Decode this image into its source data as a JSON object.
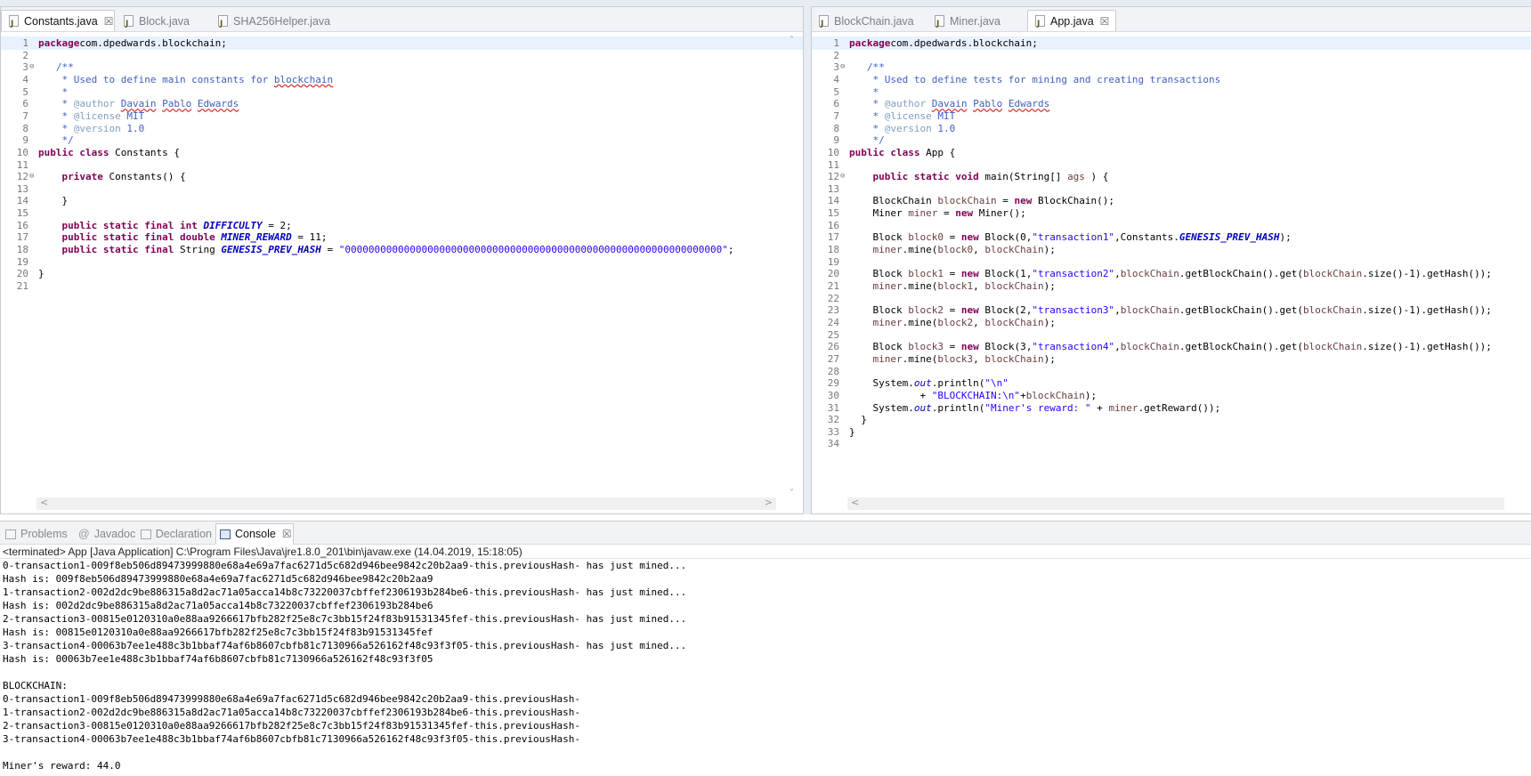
{
  "left_editor": {
    "tabs": [
      {
        "label": "Constants.java",
        "active": true,
        "close": "☒"
      },
      {
        "label": "Block.java",
        "active": false
      },
      {
        "label": "SHA256Helper.java",
        "active": false
      }
    ],
    "lines": [
      [
        [
          "kw",
          "package"
        ],
        [
          "",
          "com.dpedwards.blockchain;"
        ]
      ],
      [],
      [
        [
          "cm",
          "   /**"
        ]
      ],
      [
        [
          "cm",
          "    * Used to define main constants for "
        ],
        [
          "cm ul",
          "blockchain"
        ]
      ],
      [
        [
          "cm",
          "    *"
        ]
      ],
      [
        [
          "cm",
          "    * "
        ],
        [
          "tag",
          "@author"
        ],
        [
          "cm",
          " "
        ],
        [
          "cm ul",
          "Davain"
        ],
        [
          "cm",
          " "
        ],
        [
          "cm ul",
          "Pablo"
        ],
        [
          "cm",
          " "
        ],
        [
          "cm ul",
          "Edwards"
        ]
      ],
      [
        [
          "cm",
          "    * "
        ],
        [
          "tag",
          "@license"
        ],
        [
          "cm",
          " MIT"
        ]
      ],
      [
        [
          "cm",
          "    * "
        ],
        [
          "tag",
          "@version"
        ],
        [
          "cm",
          " 1.0"
        ]
      ],
      [
        [
          "cm",
          "    */"
        ]
      ],
      [
        [
          "kw",
          "public"
        ],
        [
          "",
          " "
        ],
        [
          "kw",
          "class"
        ],
        [
          "",
          " Constants {"
        ]
      ],
      [],
      [
        [
          "",
          "    "
        ],
        [
          "kw",
          "private"
        ],
        [
          "",
          " Constants() {"
        ]
      ],
      [],
      [
        [
          "",
          "    }"
        ]
      ],
      [],
      [
        [
          "",
          "    "
        ],
        [
          "kw",
          "public static final int"
        ],
        [
          "",
          " "
        ],
        [
          "cst",
          "DIFFICULTY"
        ],
        [
          "",
          " = 2;"
        ]
      ],
      [
        [
          "",
          "    "
        ],
        [
          "kw",
          "public static final double"
        ],
        [
          "",
          " "
        ],
        [
          "cst",
          "MINER_REWARD"
        ],
        [
          "",
          " = 11;"
        ]
      ],
      [
        [
          "",
          "    "
        ],
        [
          "kw",
          "public static final"
        ],
        [
          "",
          " String "
        ],
        [
          "cst",
          "GENESIS_PREV_HASH"
        ],
        [
          "",
          " = "
        ],
        [
          "str",
          "\"0000000000000000000000000000000000000000000000000000000000000000\""
        ],
        [
          "",
          ";"
        ]
      ],
      [],
      [
        [
          "",
          "}"
        ]
      ],
      []
    ],
    "fold_lines": [
      3,
      12
    ]
  },
  "right_editor": {
    "tabs": [
      {
        "label": "BlockChain.java",
        "active": false
      },
      {
        "label": "Miner.java",
        "active": false
      },
      {
        "label": "App.java",
        "active": true,
        "close": "☒"
      }
    ],
    "lines": [
      [
        [
          "kw",
          "package"
        ],
        [
          "",
          "com.dpedwards.blockchain;"
        ]
      ],
      [],
      [
        [
          "cm",
          "   /**"
        ]
      ],
      [
        [
          "cm",
          "    * Used to define tests for mining and creating transactions"
        ]
      ],
      [
        [
          "cm",
          "    *"
        ]
      ],
      [
        [
          "cm",
          "    * "
        ],
        [
          "tag",
          "@author"
        ],
        [
          "cm",
          " "
        ],
        [
          "cm ul",
          "Davain"
        ],
        [
          "cm",
          " "
        ],
        [
          "cm ul",
          "Pablo"
        ],
        [
          "cm",
          " "
        ],
        [
          "cm ul",
          "Edwards"
        ]
      ],
      [
        [
          "cm",
          "    * "
        ],
        [
          "tag",
          "@license"
        ],
        [
          "cm",
          " MIT"
        ]
      ],
      [
        [
          "cm",
          "    * "
        ],
        [
          "tag",
          "@version"
        ],
        [
          "cm",
          " 1.0"
        ]
      ],
      [
        [
          "cm",
          "    */"
        ]
      ],
      [
        [
          "kw",
          "public"
        ],
        [
          "",
          " "
        ],
        [
          "kw",
          "class"
        ],
        [
          "",
          " App {"
        ]
      ],
      [],
      [
        [
          "",
          "    "
        ],
        [
          "kw",
          "public static void"
        ],
        [
          "",
          " main(String[] "
        ],
        [
          "var",
          "ags"
        ],
        [
          "",
          " ) {"
        ]
      ],
      [],
      [
        [
          "",
          "    BlockChain "
        ],
        [
          "var",
          "blockChain"
        ],
        [
          "",
          " = "
        ],
        [
          "kw",
          "new"
        ],
        [
          "",
          " BlockChain();"
        ]
      ],
      [
        [
          "",
          "    Miner "
        ],
        [
          "var",
          "miner"
        ],
        [
          "",
          " = "
        ],
        [
          "kw",
          "new"
        ],
        [
          "",
          " Miner();"
        ]
      ],
      [],
      [
        [
          "",
          "    Block "
        ],
        [
          "var",
          "block0"
        ],
        [
          "",
          " = "
        ],
        [
          "kw",
          "new"
        ],
        [
          "",
          " Block(0,"
        ],
        [
          "str",
          "\"transaction1\""
        ],
        [
          "",
          ",Constants."
        ],
        [
          "cst",
          "GENESIS_PREV_HASH"
        ],
        [
          "",
          ");"
        ]
      ],
      [
        [
          "",
          "    "
        ],
        [
          "var",
          "miner"
        ],
        [
          "",
          ".mine("
        ],
        [
          "var",
          "block0"
        ],
        [
          "",
          ", "
        ],
        [
          "var",
          "blockChain"
        ],
        [
          "",
          ");"
        ]
      ],
      [],
      [
        [
          "",
          "    Block "
        ],
        [
          "var",
          "block1"
        ],
        [
          "",
          " = "
        ],
        [
          "kw",
          "new"
        ],
        [
          "",
          " Block(1,"
        ],
        [
          "str",
          "\"transaction2\""
        ],
        [
          "",
          ","
        ],
        [
          "var",
          "blockChain"
        ],
        [
          "",
          ".getBlockChain().get("
        ],
        [
          "var",
          "blockChain"
        ],
        [
          "",
          ".size()-1).getHash());"
        ]
      ],
      [
        [
          "",
          "    "
        ],
        [
          "var",
          "miner"
        ],
        [
          "",
          ".mine("
        ],
        [
          "var",
          "block1"
        ],
        [
          "",
          ", "
        ],
        [
          "var",
          "blockChain"
        ],
        [
          "",
          ");"
        ]
      ],
      [],
      [
        [
          "",
          "    Block "
        ],
        [
          "var",
          "block2"
        ],
        [
          "",
          " = "
        ],
        [
          "kw",
          "new"
        ],
        [
          "",
          " Block(2,"
        ],
        [
          "str",
          "\"transaction3\""
        ],
        [
          "",
          ","
        ],
        [
          "var",
          "blockChain"
        ],
        [
          "",
          ".getBlockChain().get("
        ],
        [
          "var",
          "blockChain"
        ],
        [
          "",
          ".size()-1).getHash());"
        ]
      ],
      [
        [
          "",
          "    "
        ],
        [
          "var",
          "miner"
        ],
        [
          "",
          ".mine("
        ],
        [
          "var",
          "block2"
        ],
        [
          "",
          ", "
        ],
        [
          "var",
          "blockChain"
        ],
        [
          "",
          ");"
        ]
      ],
      [],
      [
        [
          "",
          "    Block "
        ],
        [
          "var",
          "block3"
        ],
        [
          "",
          " = "
        ],
        [
          "kw",
          "new"
        ],
        [
          "",
          " Block(3,"
        ],
        [
          "str",
          "\"transaction4\""
        ],
        [
          "",
          ","
        ],
        [
          "var",
          "blockChain"
        ],
        [
          "",
          ".getBlockChain().get("
        ],
        [
          "var",
          "blockChain"
        ],
        [
          "",
          ".size()-1).getHash());"
        ]
      ],
      [
        [
          "",
          "    "
        ],
        [
          "var",
          "miner"
        ],
        [
          "",
          ".mine("
        ],
        [
          "var",
          "block3"
        ],
        [
          "",
          ", "
        ],
        [
          "var",
          "blockChain"
        ],
        [
          "",
          ");"
        ]
      ],
      [],
      [
        [
          "",
          "    System."
        ],
        [
          "fld",
          "out"
        ],
        [
          "",
          ".println("
        ],
        [
          "str",
          "\"\\n\""
        ]
      ],
      [
        [
          "",
          "            + "
        ],
        [
          "str",
          "\"BLOCKCHAIN:\\n\""
        ],
        [
          "",
          "+"
        ],
        [
          "var",
          "blockChain"
        ],
        [
          "",
          ");"
        ]
      ],
      [
        [
          "",
          "    System."
        ],
        [
          "fld",
          "out"
        ],
        [
          "",
          ".println("
        ],
        [
          "str",
          "\"Miner's reward: \""
        ],
        [
          "",
          " + "
        ],
        [
          "var",
          "miner"
        ],
        [
          "",
          ".getReward());"
        ]
      ],
      [
        [
          "",
          "  }"
        ]
      ],
      [
        [
          "",
          "}"
        ]
      ],
      []
    ],
    "fold_lines": [
      3,
      12
    ]
  },
  "console": {
    "tabs": [
      {
        "label": "Problems",
        "active": false
      },
      {
        "label": "Javadoc",
        "active": false
      },
      {
        "label": "Declaration",
        "active": false
      },
      {
        "label": "Console",
        "active": true,
        "close": "☒"
      }
    ],
    "terminated": "<terminated> App [Java Application] C:\\Program Files\\Java\\jre1.8.0_201\\bin\\javaw.exe (14.04.2019, 15:18:05)",
    "output": [
      "0-transaction1-009f8eb506d89473999880e68a4e69a7fac6271d5c682d946bee9842c20b2aa9-this.previousHash- has just mined...",
      "Hash is: 009f8eb506d89473999880e68a4e69a7fac6271d5c682d946bee9842c20b2aa9",
      "1-transaction2-002d2dc9be886315a8d2ac71a05acca14b8c73220037cbffef2306193b284be6-this.previousHash- has just mined...",
      "Hash is: 002d2dc9be886315a8d2ac71a05acca14b8c73220037cbffef2306193b284be6",
      "2-transaction3-00815e0120310a0e88aa9266617bfb282f25e8c7c3bb15f24f83b91531345fef-this.previousHash- has just mined...",
      "Hash is: 00815e0120310a0e88aa9266617bfb282f25e8c7c3bb15f24f83b91531345fef",
      "3-transaction4-00063b7ee1e488c3b1bbaf74af6b8607cbfb81c7130966a526162f48c93f3f05-this.previousHash- has just mined...",
      "Hash is: 00063b7ee1e488c3b1bbaf74af6b8607cbfb81c7130966a526162f48c93f3f05",
      "",
      "BLOCKCHAIN:",
      "0-transaction1-009f8eb506d89473999880e68a4e69a7fac6271d5c682d946bee9842c20b2aa9-this.previousHash-",
      "1-transaction2-002d2dc9be886315a8d2ac71a05acca14b8c73220037cbffef2306193b284be6-this.previousHash-",
      "2-transaction3-00815e0120310a0e88aa9266617bfb282f25e8c7c3bb15f24f83b91531345fef-this.previousHash-",
      "3-transaction4-00063b7ee1e488c3b1bbaf74af6b8607cbfb81c7130966a526162f48c93f3f05-this.previousHash-",
      "",
      "Miner's reward: 44.0"
    ]
  }
}
